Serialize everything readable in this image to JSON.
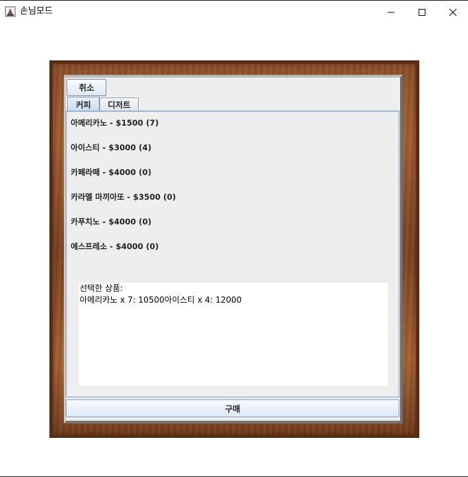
{
  "window": {
    "title": "손님모드",
    "controls": {
      "minimize": "minimize-icon",
      "maximize": "maximize-icon",
      "close": "close-icon"
    }
  },
  "toolbar": {
    "cancel_label": "취소"
  },
  "tabs": [
    {
      "label": "커피",
      "active": true
    },
    {
      "label": "디저트",
      "active": false
    }
  ],
  "menu": {
    "items": [
      {
        "label": "아메리카노 - $1500 (7)"
      },
      {
        "label": "아이스티 - $3000 (4)"
      },
      {
        "label": "카페라떼 - $4000 (0)"
      },
      {
        "label": "카라멜 마끼아또 - $3500 (0)"
      },
      {
        "label": "카푸치노 - $4000 (0)"
      },
      {
        "label": "에스프레소 - $4000 (0)"
      }
    ]
  },
  "selection": {
    "title": "선택한 상품:",
    "summary": "아메리카노 x 7: 10500아이스티 x 4: 12000"
  },
  "footer": {
    "buy_label": "구매"
  },
  "colors": {
    "frame_wood": "#8a4f2a",
    "panel_bg": "#eeeeee",
    "tab_border": "#7a9cc5"
  }
}
